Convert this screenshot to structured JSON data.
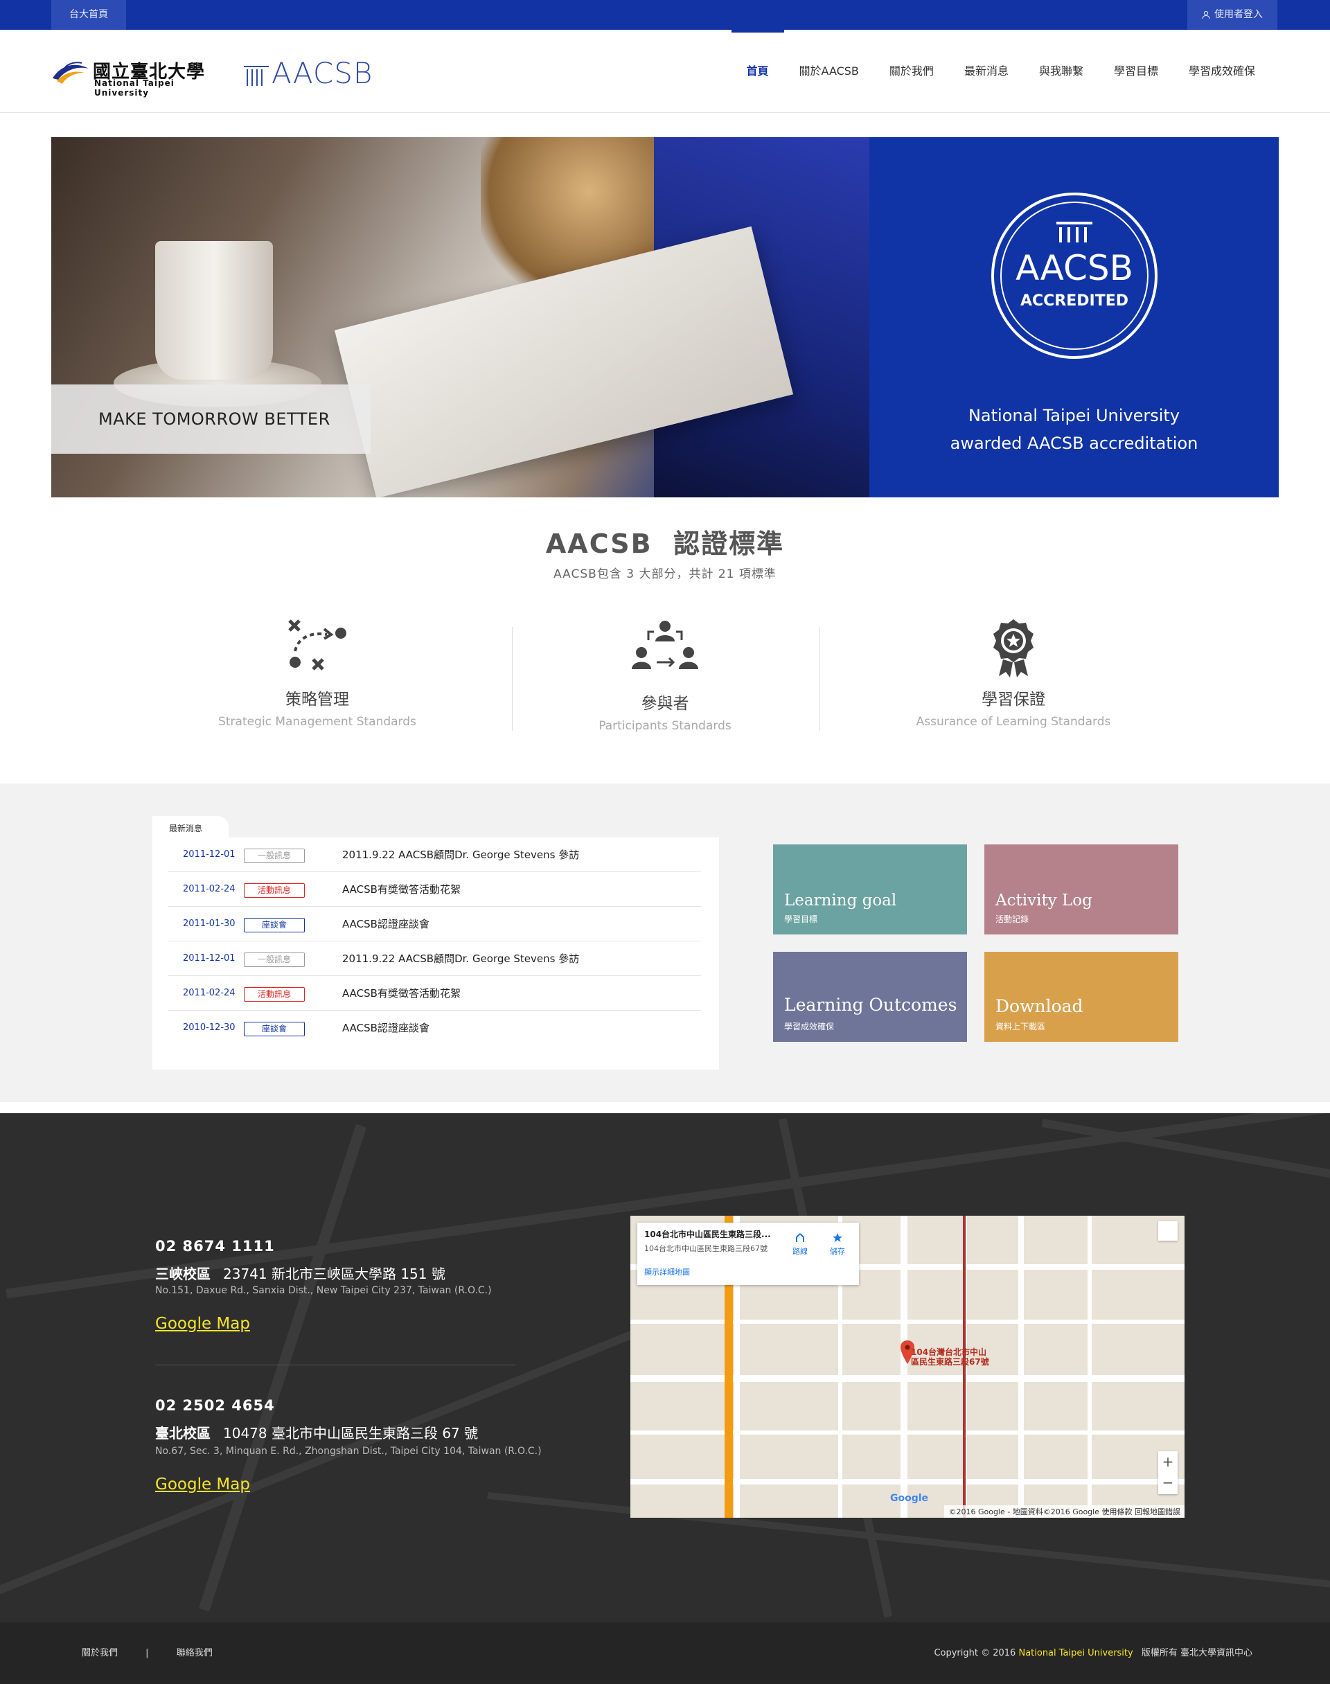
{
  "topbar": {
    "home": "台大首頁",
    "login": "使用者登入"
  },
  "logo": {
    "ntpu_zh": "國立臺北大學",
    "ntpu_en": "National Taipei University",
    "aacsb": "AACSB"
  },
  "nav": [
    "首頁",
    "關於AACSB",
    "關於我們",
    "最新消息",
    "與我聯繫",
    "學習目標",
    "學習成效確保"
  ],
  "hero": {
    "slogan": "MAKE TOMORROW BETTER",
    "badge_top": "AACSB",
    "badge_bottom": "ACCREDITED",
    "line1": "National Taipei University",
    "line2": "awarded AACSB accreditation"
  },
  "standards": {
    "title": "AACSB  認證標準",
    "subtitle": "AACSB包含 3 大部分，共計 21 項標準",
    "items": [
      {
        "zh": "策略管理",
        "en": "Strategic Management Standards",
        "icon": "strategy-icon"
      },
      {
        "zh": "參與者",
        "en": "Participants Standards",
        "icon": "people-icon"
      },
      {
        "zh": "學習保證",
        "en": "Assurance of Learning Standards",
        "icon": "award-icon"
      }
    ]
  },
  "news": {
    "tab": "最新消息",
    "rows": [
      {
        "date": "2011-12-01",
        "tag": "一般訊息",
        "title": "2011.9.22 AACSB顧問Dr. George Stevens 參訪"
      },
      {
        "date": "2011-02-24",
        "tag": "活動訊息",
        "title": "AACSB有獎徵答活動花絮"
      },
      {
        "date": "2011-01-30",
        "tag": "座談會",
        "title": "AACSB認證座談會"
      },
      {
        "date": "2011-12-01",
        "tag": "一般訊息",
        "title": "2011.9.22 AACSB顧問Dr. George Stevens 參訪"
      },
      {
        "date": "2011-02-24",
        "tag": "活動訊息",
        "title": "AACSB有獎徵答活動花絮"
      },
      {
        "date": "2010-12-30",
        "tag": "座談會",
        "title": "AACSB認證座談會"
      }
    ]
  },
  "tiles": [
    {
      "en": "Learning goal",
      "zh": "學習目標",
      "color": "#6aa3a1"
    },
    {
      "en": "Activity Log",
      "zh": "活動記錄",
      "color": "#b5828b"
    },
    {
      "en": "Learning Outcomes",
      "zh": "學習成效確保",
      "color": "#6f7599"
    },
    {
      "en": "Download",
      "zh": "資料上下載區",
      "color": "#d9a04c"
    }
  ],
  "contact": {
    "phone1": "02 8674 1111",
    "campus1": "三峽校區",
    "addr1": "23741 新北市三峽區大學路 151 號",
    "addr1_en": "No.151, Daxue Rd., Sanxia Dist., New Taipei City 237, Taiwan (R.O.C.)",
    "map1": "Google Map",
    "phone2": "02 2502 4654",
    "campus2": "臺北校區",
    "addr2": "10478 臺北市中山區民生東路三段 67 號",
    "addr2_en": "No.67, Sec. 3, Minquan E. Rd., Zhongshan Dist., Taipei City 104, Taiwan (R.O.C.)",
    "map2": "Google Map"
  },
  "map": {
    "card_title": "104台北市中山區民生東路三段...",
    "card_addr": "104台北市中山區民生東路三段67號",
    "card_link": "顯示詳細地圖",
    "directions": "路線",
    "save": "儲存",
    "pin_label_1": "104台灣台北市中山",
    "pin_label_2": "區民生東路三段67號",
    "google": "Google",
    "copyright": "©2016 Google - 地圖資料©2016 Google   使用條款   回報地圖錯誤"
  },
  "footer": {
    "about": "關於我們",
    "sep": "|",
    "contact": "聯絡我們",
    "copy_pre": "Copyright © 2016",
    "copy_name": "National Taipei University",
    "copy_post": "版權所有 臺北大學資訊中心"
  },
  "colors": {
    "brand": "#1133a3",
    "accent_yellow": "#f6e52b"
  }
}
